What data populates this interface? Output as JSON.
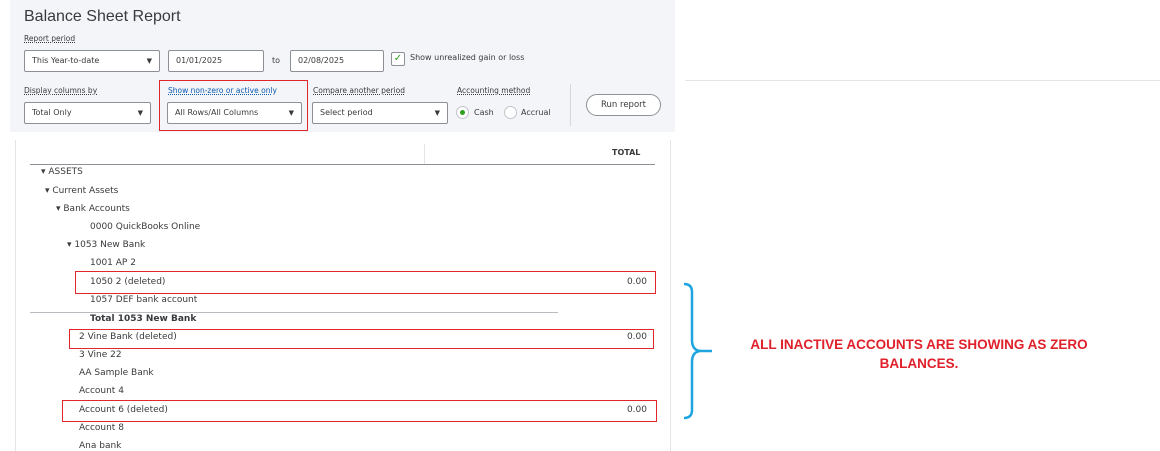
{
  "header": {
    "title": "Balance Sheet Report",
    "report_period_label": "Report period",
    "period_value": "This Year-to-date",
    "from_date": "01/01/2025",
    "to_label": "to",
    "to_date": "02/08/2025",
    "unrealized_label": "Show unrealized gain or loss",
    "unrealized_checked": "✓"
  },
  "filters": {
    "display_columns_label": "Display columns by",
    "display_columns_value": "Total Only",
    "nonzero_label": "Show non-zero or active only",
    "nonzero_value": "All Rows/All Columns",
    "compare_label": "Compare another period",
    "compare_value": "Select period",
    "accounting_label": "Accounting method",
    "cash_label": "Cash",
    "accrual_label": "Accrual",
    "run_label": "Run report"
  },
  "report": {
    "total_header": "TOTAL",
    "rows": [
      {
        "label": "▾ ASSETS",
        "amount": ""
      },
      {
        "label": "▾ Current Assets",
        "amount": ""
      },
      {
        "label": "▾ Bank Accounts",
        "amount": ""
      },
      {
        "label": "0000 QuickBooks Online",
        "amount": ""
      },
      {
        "label": "▾ 1053 New Bank",
        "amount": ""
      },
      {
        "label": "1001 AP 2",
        "amount": ""
      },
      {
        "label": "1050 2 (deleted)",
        "amount": "0.00"
      },
      {
        "label": "1057 DEF bank account",
        "amount": ""
      },
      {
        "label": "Total 1053 New Bank",
        "amount": ""
      },
      {
        "label": "2 Vine Bank (deleted)",
        "amount": "0.00"
      },
      {
        "label": "3 Vine 22",
        "amount": ""
      },
      {
        "label": "AA Sample Bank",
        "amount": ""
      },
      {
        "label": "Account 4",
        "amount": ""
      },
      {
        "label": "Account 6 (deleted)",
        "amount": "0.00"
      },
      {
        "label": "Account 8",
        "amount": ""
      },
      {
        "label": "Ana bank",
        "amount": ""
      }
    ]
  },
  "annotation": {
    "line1": "ALL INACTIVE ACCOUNTS ARE SHOWING AS ZERO",
    "line2": "BALANCES."
  },
  "colors": {
    "highlight": "#e0282c",
    "bracket": "#1ea5e0",
    "annotation": "#e0202a",
    "radio_on": "#2ca01c"
  },
  "icons": {
    "dropdown": "chevron-down-icon",
    "expand": "caret-down-icon",
    "check": "checkmark-icon"
  }
}
